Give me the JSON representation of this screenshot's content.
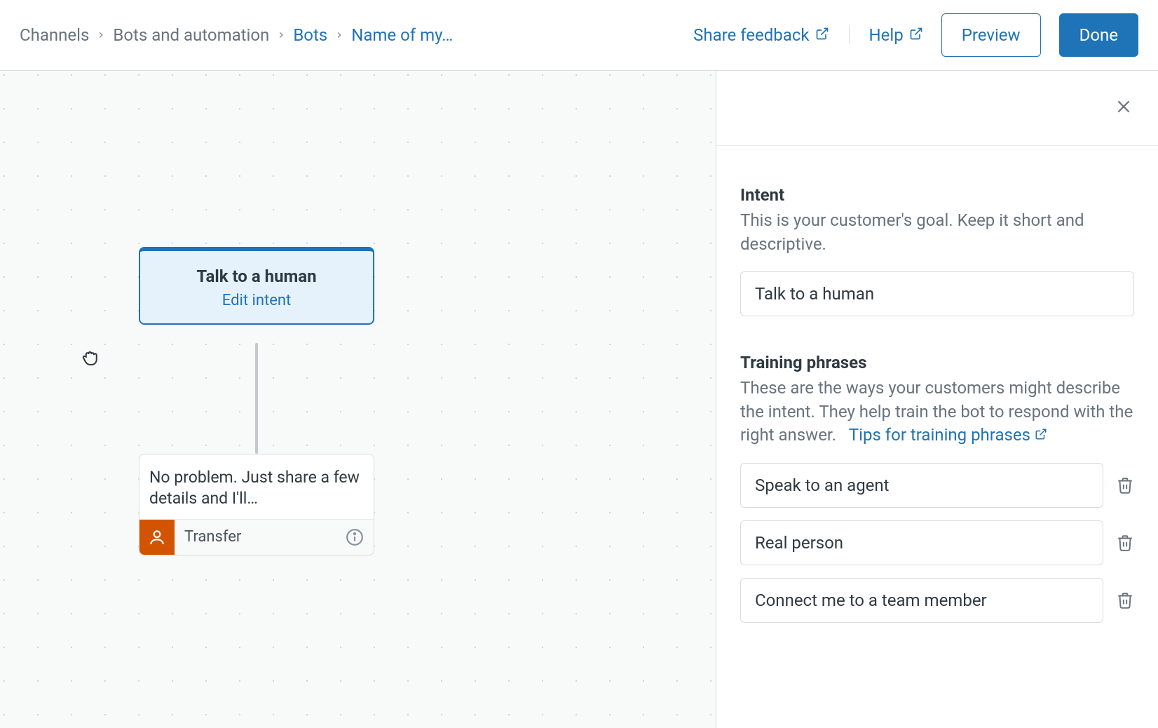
{
  "header": {
    "breadcrumbs": [
      "Channels",
      "Bots and automation",
      "Bots",
      "Name of my…"
    ],
    "share_feedback": "Share feedback",
    "help": "Help",
    "preview": "Preview",
    "done": "Done"
  },
  "canvas": {
    "intent_title": "Talk to a human",
    "edit_intent": "Edit intent",
    "response_text": "No problem. Just share a few details and I'll…",
    "transfer_label": "Transfer"
  },
  "panel": {
    "intent": {
      "title": "Intent",
      "description": "This is your customer's goal. Keep it short and descriptive.",
      "value": "Talk to a human"
    },
    "training": {
      "title": "Training phrases",
      "description": "These are the ways your customers might describe the intent. They help train the bot to respond with the right answer.",
      "tips_link": "Tips for training phrases",
      "phrases": [
        "Speak to an agent",
        "Real person",
        "Connect me to a team member"
      ]
    }
  }
}
